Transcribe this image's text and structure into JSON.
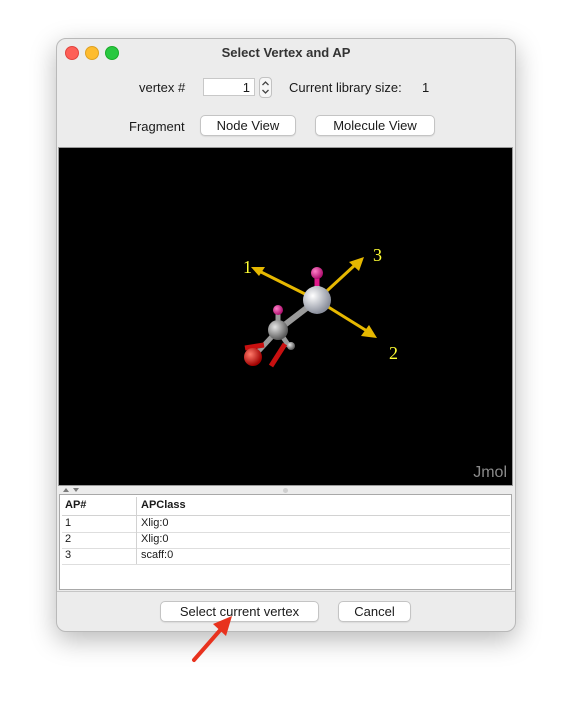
{
  "window": {
    "title": "Select Vertex and AP"
  },
  "vertex": {
    "label": "vertex #",
    "value": "1",
    "library_label": "Current library size:",
    "library_value": "1"
  },
  "fragment": {
    "label": "Fragment",
    "node_view": "Node View",
    "molecule_view": "Molecule View"
  },
  "viewer": {
    "watermark": "Jmol",
    "ap_labels": [
      "1",
      "2",
      "3"
    ],
    "colors": {
      "background": "#000000",
      "arrows": "#e6b800",
      "labels": "#ffff33",
      "carbon": "#9a9a9a",
      "hydrogen": "#e0188a",
      "oxygen": "#e01010"
    }
  },
  "table": {
    "headers": [
      "AP#",
      "APClass"
    ],
    "rows": [
      [
        "1",
        "Xlig:0"
      ],
      [
        "2",
        "Xlig:0"
      ],
      [
        "3",
        "scaff:0"
      ]
    ]
  },
  "buttons": {
    "select": "Select current vertex",
    "cancel": "Cancel"
  },
  "annotation": {
    "arrow_color": "#e8321e"
  }
}
